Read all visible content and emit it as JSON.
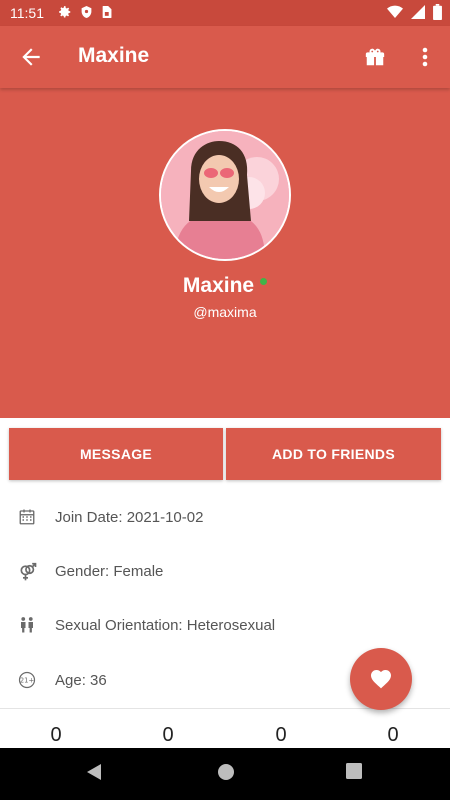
{
  "status_bar": {
    "time": "11:51",
    "left_icons": [
      "gear-icon",
      "shield-icon",
      "sim-card-icon"
    ],
    "right_icons": [
      "wifi-icon",
      "signal-icon",
      "battery-icon"
    ]
  },
  "app_bar": {
    "title": "Maxine",
    "icons": [
      "back-arrow-icon",
      "gift-icon",
      "more-vert-icon"
    ]
  },
  "profile": {
    "name": "Maxine",
    "handle": "@maxima",
    "online": true,
    "online_color": "#3fb548"
  },
  "actions": {
    "message_label": "MESSAGE",
    "add_friends_label": "ADD TO FRIENDS"
  },
  "info": [
    {
      "icon": "calendar-icon",
      "text": "Join Date: 2021-10-02"
    },
    {
      "icon": "gender-icon",
      "text": "Gender: Female"
    },
    {
      "icon": "people-icon",
      "text": "Sexual Orientation: Heterosexual"
    },
    {
      "icon": "age-icon",
      "text": "Age: 36"
    }
  ],
  "stats": [
    "0",
    "0",
    "0",
    "0"
  ],
  "fab": {
    "icon": "heart-icon"
  },
  "colors": {
    "primary": "#d95a4c",
    "primary_dark": "#c8493c",
    "text_secondary": "#555555"
  },
  "nav_bar": [
    "back-triangle-icon",
    "home-circle-icon",
    "recents-square-icon"
  ]
}
